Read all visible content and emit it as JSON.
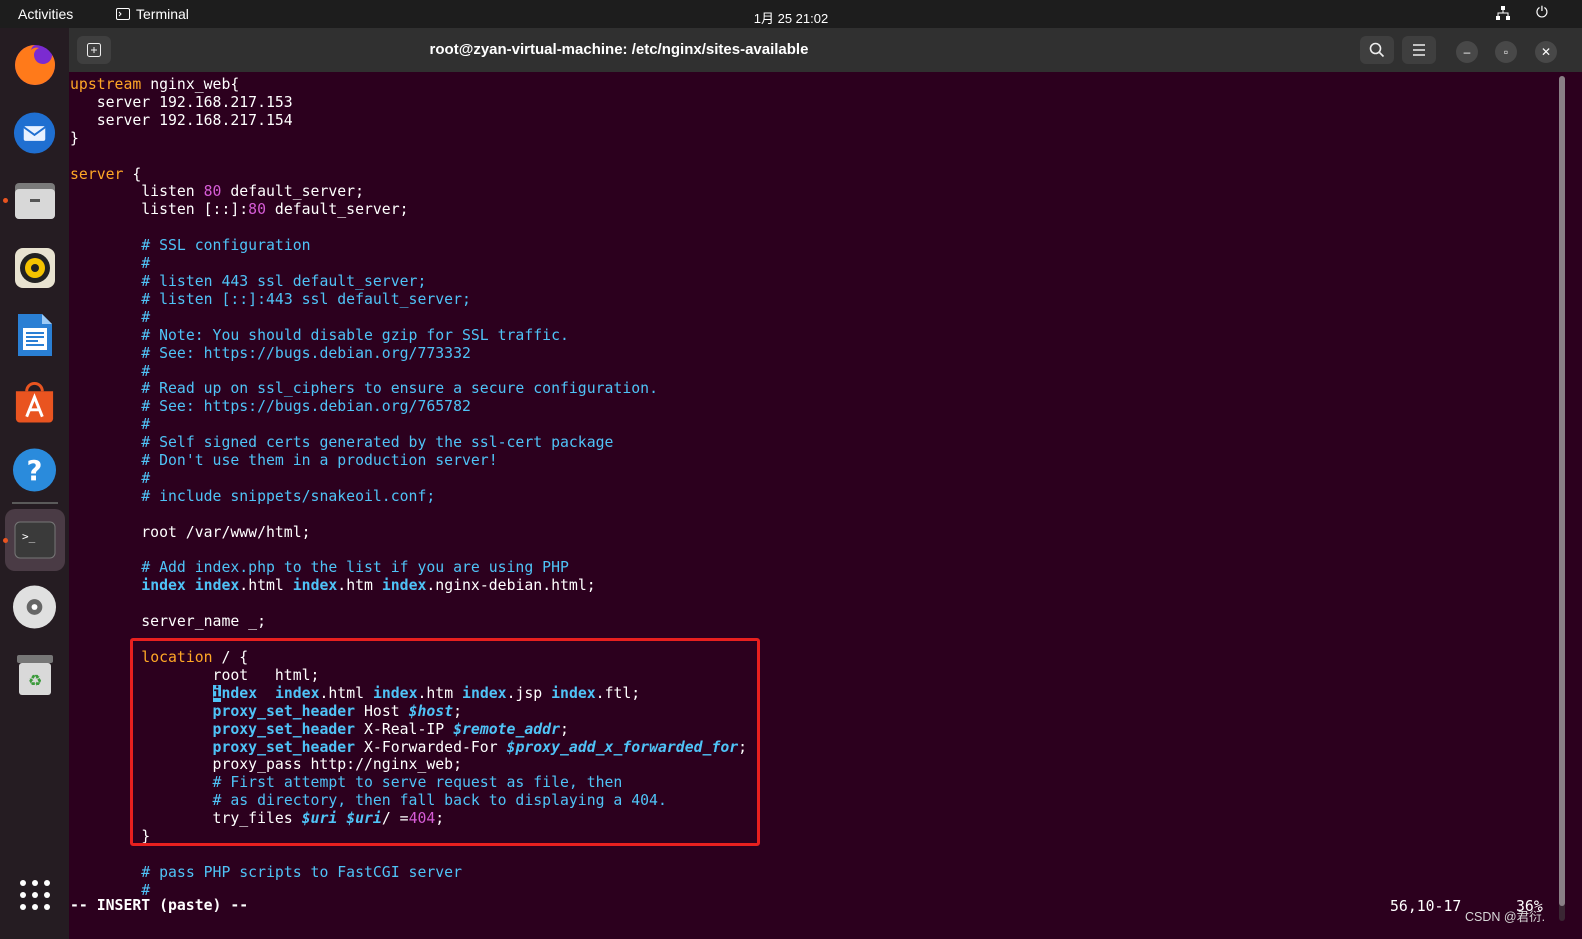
{
  "topbar": {
    "activities": "Activities",
    "app_name": "Terminal",
    "clock": "1月 25  21:02"
  },
  "dock": {
    "items": [
      {
        "name": "firefox-icon",
        "color": "#e66000"
      },
      {
        "name": "thunderbird-icon",
        "color": "#2a7fd4"
      },
      {
        "name": "files-icon",
        "color": "#8d8d8d"
      },
      {
        "name": "rhythmbox-icon",
        "color": "#f5c400"
      },
      {
        "name": "libreoffice-writer-icon",
        "color": "#2a7fd4"
      },
      {
        "name": "app-center-icon",
        "color": "#e95420"
      },
      {
        "name": "help-icon",
        "color": "#2a8bdc"
      },
      {
        "name": "terminal-icon",
        "color": "#3a3a3a"
      },
      {
        "name": "disc-icon",
        "color": "#d0d0d0"
      },
      {
        "name": "trash-icon",
        "color": "#9a9a9a"
      }
    ]
  },
  "window": {
    "title": "root@zyan-virtual-machine: /etc/nginx/sites-available"
  },
  "editor": {
    "lines": [
      "upstream nginx_web{",
      "   server 192.168.217.153",
      "   server 192.168.217.154",
      "}",
      "",
      "server {",
      "        listen 80 default_server;",
      "        listen [::]:80 default_server;",
      "",
      "        # SSL configuration",
      "        #",
      "        # listen 443 ssl default_server;",
      "        # listen [::]:443 ssl default_server;",
      "        #",
      "        # Note: You should disable gzip for SSL traffic.",
      "        # See: https://bugs.debian.org/773332",
      "        #",
      "        # Read up on ssl_ciphers to ensure a secure configuration.",
      "        # See: https://bugs.debian.org/765782",
      "        #",
      "        # Self signed certs generated by the ssl-cert package",
      "        # Don't use them in a production server!",
      "        #",
      "        # include snippets/snakeoil.conf;",
      "",
      "        root /var/www/html;",
      "",
      "        # Add index.php to the list if you are using PHP",
      "        index index.html index.htm index.nginx-debian.html;",
      "",
      "        server_name _;",
      "",
      "        location / {",
      "                root   html;",
      "                index  index.html index.htm index.jsp index.ftl;",
      "                proxy_set_header Host $host;",
      "                proxy_set_header X-Real-IP $remote_addr;",
      "                proxy_set_header X-Forwarded-For $proxy_add_x_forwarded_for;",
      "                proxy_pass http://nginx_web;",
      "                # First attempt to serve request as file, then",
      "                # as directory, then fall back to displaying a 404.",
      "                try_files $uri $uri/ =404;",
      "        }",
      "",
      "        # pass PHP scripts to FastCGI server",
      "        #"
    ],
    "mode": "-- INSERT (paste) --",
    "cursor_position": "56,10-17",
    "scroll_percent": "36%",
    "colors": {
      "background": "#2c001e",
      "keyword": "#ffa726",
      "comment": "#4fc3f7",
      "number": "#d65cd6",
      "highlight_box": "#e8201f"
    }
  },
  "watermark": "CSDN @君衍."
}
